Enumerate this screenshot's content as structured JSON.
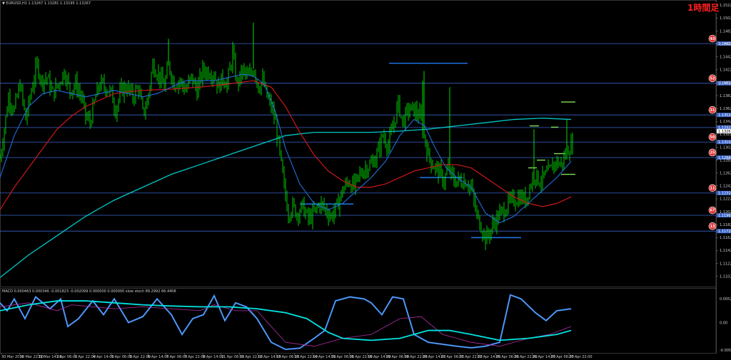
{
  "header": {
    "main_title": "▼ EURUSD,H1  1.13267 1.13281 1.13195 1.13267",
    "timeframe_badge": "1時間足",
    "macd_title": "MACD 0.000463 0.000346 -0.001823 -0.002099 0.000000 0.000000  slow stoch 89.2992 66.4408"
  },
  "colors": {
    "candle": "#00dd00",
    "sma_blue": "#1e6fd9",
    "sma_red": "#cc1818",
    "sma_cyan": "#00c8c8",
    "hline": "#3a64c8",
    "segment_blue": "#1e6fd9",
    "segment_green": "#7fe05a",
    "marker_red": "#e03030"
  },
  "chart_data": {
    "type": "candlestick",
    "symbol": "EURUSD",
    "timeframe": "H1",
    "ylim": [
      1.1085,
      1.153
    ],
    "price_ticks": [
      "1.15220",
      "1.15020",
      "1.14820",
      "1.14620",
      "1.14420",
      "1.14220",
      "1.14020",
      "1.13820",
      "1.13620",
      "1.13420",
      "1.13220",
      "1.13020",
      "1.12820",
      "1.12620",
      "1.12420",
      "1.12220",
      "1.12020",
      "1.11820",
      "1.11620",
      "1.11420",
      "1.11220",
      "1.11020"
    ],
    "x_ticks": [
      "30 Mar 2016",
      "30 Mar 22:00",
      "31 Mar 14:00",
      "1 Apr 06:00",
      "1 Apr 22:00",
      "4 Apr 14:00",
      "5 Apr 06:00",
      "5 Apr 22:00",
      "6 Apr 14:00",
      "7 Apr 06:00",
      "7 Apr 22:00",
      "8 Apr 14:00",
      "11 Apr 06:00",
      "11 Apr 22:00",
      "12 Apr 14:00",
      "13 Apr 06:00",
      "13 Apr 22:00",
      "14 Apr 14:00",
      "15 Apr 06:00",
      "15 Apr 22:00",
      "18 Apr 14:00",
      "19 Apr 06:00",
      "19 Apr 22:00",
      "20 Apr 14:00",
      "21 Apr 06:00",
      "21 Apr 22:00",
      "22 Apr 14:00",
      "25 Apr 06:00",
      "25 Apr 22:00",
      "26 Apr 14:00",
      "27 Apr 06:00",
      "27 Apr 22:00"
    ],
    "hlines": [
      {
        "y": 1.14625,
        "label": "1.14625",
        "marker": "43"
      },
      {
        "y": 1.1401,
        "label": "1.14010",
        "marker": "52"
      },
      {
        "y": 1.1352,
        "label": "1.13520",
        "marker": "31"
      },
      {
        "y": 1.13325,
        "label": "1.13325",
        "marker": null
      },
      {
        "y": 1.131,
        "label": "1.13100",
        "marker": "50"
      },
      {
        "y": 1.1286,
        "label": "1.12860",
        "marker": "25"
      },
      {
        "y": 1.1231,
        "label": "1.12310",
        "marker": "11"
      },
      {
        "y": 1.11965,
        "label": "1.11965",
        "marker": "67"
      },
      {
        "y": 1.1172,
        "label": "1.11720",
        "marker": "13"
      }
    ],
    "current_price": "1.13267",
    "close_path": [
      [
        0,
        1.1285
      ],
      [
        6,
        1.133
      ],
      [
        12,
        1.138
      ],
      [
        20,
        1.136
      ],
      [
        28,
        1.14
      ],
      [
        36,
        1.1345
      ],
      [
        44,
        1.139
      ],
      [
        52,
        1.143
      ],
      [
        58,
        1.1405
      ],
      [
        66,
        1.141
      ],
      [
        74,
        1.1385
      ],
      [
        82,
        1.14
      ],
      [
        90,
        1.142
      ],
      [
        98,
        1.139
      ],
      [
        106,
        1.14
      ],
      [
        114,
        1.138
      ],
      [
        120,
        1.135
      ],
      [
        126,
        1.134
      ],
      [
        134,
        1.138
      ],
      [
        140,
        1.14
      ],
      [
        148,
        1.1395
      ],
      [
        156,
        1.1385
      ],
      [
        162,
        1.136
      ],
      [
        170,
        1.139
      ],
      [
        178,
        1.1395
      ],
      [
        186,
        1.138
      ],
      [
        194,
        1.1395
      ],
      [
        200,
        1.1355
      ],
      [
        206,
        1.137
      ],
      [
        214,
        1.143
      ],
      [
        222,
        1.1415
      ],
      [
        230,
        1.1395
      ],
      [
        236,
        1.143
      ],
      [
        244,
        1.14
      ],
      [
        252,
        1.1405
      ],
      [
        260,
        1.139
      ],
      [
        268,
        1.141
      ],
      [
        276,
        1.139
      ],
      [
        284,
        1.142
      ],
      [
        292,
        1.142
      ],
      [
        300,
        1.1415
      ],
      [
        306,
        1.1395
      ],
      [
        312,
        1.141
      ],
      [
        318,
        1.14
      ],
      [
        326,
        1.1445
      ],
      [
        332,
        1.14
      ],
      [
        340,
        1.142
      ],
      [
        348,
        1.141
      ],
      [
        356,
        1.1425
      ],
      [
        362,
        1.1395
      ],
      [
        368,
        1.1405
      ],
      [
        374,
        1.138
      ],
      [
        380,
        1.1365
      ],
      [
        386,
        1.134
      ],
      [
        392,
        1.129
      ],
      [
        398,
        1.124
      ],
      [
        404,
        1.12
      ],
      [
        410,
        1.121
      ],
      [
        416,
        1.12
      ],
      [
        424,
        1.121
      ],
      [
        432,
        1.119
      ],
      [
        440,
        1.12
      ],
      [
        448,
        1.1215
      ],
      [
        456,
        1.1205
      ],
      [
        464,
        1.1195
      ],
      [
        472,
        1.121
      ],
      [
        480,
        1.1235
      ],
      [
        488,
        1.125
      ],
      [
        496,
        1.124
      ],
      [
        504,
        1.126
      ],
      [
        512,
        1.127
      ],
      [
        520,
        1.1275
      ],
      [
        528,
        1.129
      ],
      [
        536,
        1.132
      ],
      [
        544,
        1.1305
      ],
      [
        552,
        1.134
      ],
      [
        558,
        1.137
      ],
      [
        564,
        1.134
      ],
      [
        572,
        1.136
      ],
      [
        580,
        1.136
      ],
      [
        588,
        1.135
      ],
      [
        594,
        1.132
      ],
      [
        600,
        1.129
      ],
      [
        606,
        1.1275
      ],
      [
        614,
        1.1265
      ],
      [
        622,
        1.125
      ],
      [
        628,
        1.127
      ],
      [
        632,
        1.126
      ],
      [
        636,
        1.125
      ],
      [
        644,
        1.125
      ],
      [
        652,
        1.125
      ],
      [
        660,
        1.124
      ],
      [
        668,
        1.1195
      ],
      [
        674,
        1.118
      ],
      [
        680,
        1.116
      ],
      [
        686,
        1.117
      ],
      [
        692,
        1.1185
      ],
      [
        698,
        1.1195
      ],
      [
        706,
        1.1205
      ],
      [
        712,
        1.1215
      ],
      [
        720,
        1.122
      ],
      [
        728,
        1.1225
      ],
      [
        736,
        1.122
      ],
      [
        742,
        1.124
      ],
      [
        748,
        1.126
      ],
      [
        756,
        1.125
      ],
      [
        762,
        1.1255
      ],
      [
        770,
        1.1265
      ],
      [
        778,
        1.128
      ],
      [
        786,
        1.1275
      ],
      [
        794,
        1.1295
      ],
      [
        800,
        1.1305
      ]
    ],
    "spikes": [
      [
        355,
        1.1495
      ],
      [
        630,
        1.1395
      ],
      [
        592,
        1.1405
      ],
      [
        594,
        1.142
      ],
      [
        236,
        1.147
      ],
      [
        326,
        1.1465
      ],
      [
        748,
        1.133
      ],
      [
        794,
        1.1345
      ]
    ],
    "sma_blue": [
      [
        0,
        1.1255
      ],
      [
        20,
        1.132
      ],
      [
        40,
        1.1365
      ],
      [
        60,
        1.1385
      ],
      [
        80,
        1.139
      ],
      [
        100,
        1.1385
      ],
      [
        120,
        1.138
      ],
      [
        140,
        1.1385
      ],
      [
        160,
        1.139
      ],
      [
        180,
        1.1385
      ],
      [
        200,
        1.138
      ],
      [
        220,
        1.1385
      ],
      [
        240,
        1.1395
      ],
      [
        260,
        1.1405
      ],
      [
        280,
        1.1405
      ],
      [
        300,
        1.1405
      ],
      [
        320,
        1.141
      ],
      [
        340,
        1.1415
      ],
      [
        355,
        1.1412
      ],
      [
        370,
        1.14
      ],
      [
        385,
        1.136
      ],
      [
        400,
        1.13
      ],
      [
        420,
        1.1245
      ],
      [
        440,
        1.1215
      ],
      [
        460,
        1.1205
      ],
      [
        480,
        1.1215
      ],
      [
        500,
        1.1235
      ],
      [
        520,
        1.1255
      ],
      [
        540,
        1.128
      ],
      [
        560,
        1.132
      ],
      [
        580,
        1.1345
      ],
      [
        595,
        1.1335
      ],
      [
        610,
        1.13
      ],
      [
        625,
        1.127
      ],
      [
        640,
        1.1255
      ],
      [
        660,
        1.124
      ],
      [
        680,
        1.12
      ],
      [
        700,
        1.1185
      ],
      [
        720,
        1.1195
      ],
      [
        740,
        1.1215
      ],
      [
        760,
        1.1235
      ],
      [
        780,
        1.1255
      ],
      [
        800,
        1.128
      ]
    ],
    "sma_red": [
      [
        0,
        1.1205
      ],
      [
        20,
        1.124
      ],
      [
        40,
        1.127
      ],
      [
        60,
        1.13
      ],
      [
        80,
        1.133
      ],
      [
        100,
        1.135
      ],
      [
        120,
        1.1365
      ],
      [
        140,
        1.1375
      ],
      [
        160,
        1.1385
      ],
      [
        180,
        1.1388
      ],
      [
        200,
        1.139
      ],
      [
        240,
        1.1392
      ],
      [
        280,
        1.1395
      ],
      [
        320,
        1.14
      ],
      [
        355,
        1.1405
      ],
      [
        380,
        1.1395
      ],
      [
        400,
        1.1365
      ],
      [
        420,
        1.1325
      ],
      [
        440,
        1.129
      ],
      [
        460,
        1.1265
      ],
      [
        480,
        1.125
      ],
      [
        500,
        1.124
      ],
      [
        520,
        1.124
      ],
      [
        540,
        1.1245
      ],
      [
        560,
        1.1255
      ],
      [
        580,
        1.1265
      ],
      [
        600,
        1.127
      ],
      [
        620,
        1.1275
      ],
      [
        640,
        1.1275
      ],
      [
        660,
        1.127
      ],
      [
        680,
        1.1255
      ],
      [
        700,
        1.124
      ],
      [
        720,
        1.1225
      ],
      [
        740,
        1.1215
      ],
      [
        760,
        1.121
      ],
      [
        780,
        1.1215
      ],
      [
        800,
        1.1225
      ]
    ],
    "sma_cyan": [
      [
        0,
        1.11
      ],
      [
        40,
        1.1135
      ],
      [
        80,
        1.1165
      ],
      [
        120,
        1.1195
      ],
      [
        160,
        1.122
      ],
      [
        200,
        1.124
      ],
      [
        240,
        1.126
      ],
      [
        280,
        1.1275
      ],
      [
        320,
        1.129
      ],
      [
        360,
        1.1305
      ],
      [
        400,
        1.132
      ],
      [
        440,
        1.1325
      ],
      [
        480,
        1.1325
      ],
      [
        520,
        1.1325
      ],
      [
        560,
        1.1327
      ],
      [
        600,
        1.133
      ],
      [
        640,
        1.1335
      ],
      [
        680,
        1.134
      ],
      [
        720,
        1.1345
      ],
      [
        760,
        1.1347
      ],
      [
        800,
        1.1345
      ]
    ],
    "segments_blue": [
      [
        545,
        605,
        1.1432
      ],
      [
        605,
        655,
        1.1432
      ],
      [
        588,
        648,
        1.1255
      ],
      [
        420,
        495,
        1.1214
      ],
      [
        660,
        730,
        1.1162
      ]
    ],
    "segments_green": [
      [
        786,
        806,
        1.1372
      ],
      [
        742,
        755,
        1.1335
      ],
      [
        772,
        782,
        1.1333
      ],
      [
        740,
        752,
        1.127
      ],
      [
        752,
        764,
        1.1282
      ],
      [
        776,
        792,
        1.1292
      ],
      [
        786,
        806,
        1.126
      ]
    ],
    "macd": {
      "ylim": [
        -0.0075,
        0.0075
      ],
      "tick_labels": [
        "0.005271",
        "0.00",
        "-0.005794"
      ],
      "line_cyan": [
        [
          0,
          0.003
        ],
        [
          40,
          0.0045
        ],
        [
          80,
          0.0055
        ],
        [
          120,
          0.0055
        ],
        [
          160,
          0.005
        ],
        [
          200,
          0.0045
        ],
        [
          240,
          0.0042
        ],
        [
          280,
          0.004
        ],
        [
          320,
          0.004
        ],
        [
          360,
          0.0035
        ],
        [
          400,
          0.0025
        ],
        [
          430,
          0.001
        ],
        [
          460,
          -0.0025
        ],
        [
          480,
          -0.004
        ],
        [
          520,
          -0.0045
        ],
        [
          560,
          -0.004
        ],
        [
          600,
          -0.002
        ],
        [
          630,
          -0.002
        ],
        [
          660,
          -0.003
        ],
        [
          700,
          -0.0045
        ],
        [
          740,
          -0.004
        ],
        [
          780,
          -0.003
        ],
        [
          800,
          -0.002
        ]
      ],
      "line_purple": [
        [
          0,
          0.004
        ],
        [
          40,
          0.005
        ],
        [
          80,
          0.003
        ],
        [
          100,
          0.0045
        ],
        [
          130,
          0.004
        ],
        [
          160,
          0.0035
        ],
        [
          200,
          0.004
        ],
        [
          240,
          0.0035
        ],
        [
          280,
          0.003
        ],
        [
          300,
          0.0045
        ],
        [
          330,
          0.003
        ],
        [
          360,
          0.003
        ],
        [
          400,
          -0.005
        ],
        [
          440,
          -0.006
        ],
        [
          480,
          -0.004
        ],
        [
          520,
          -0.003
        ],
        [
          560,
          0.001
        ],
        [
          590,
          0.0015
        ],
        [
          620,
          -0.003
        ],
        [
          660,
          -0.005
        ],
        [
          700,
          -0.006
        ],
        [
          740,
          -0.004
        ],
        [
          770,
          -0.003
        ],
        [
          800,
          -0.001
        ]
      ],
      "stoch_blue": [
        [
          0,
          0.005
        ],
        [
          10,
          0.003
        ],
        [
          20,
          0.006
        ],
        [
          35,
          0.001
        ],
        [
          50,
          0.0065
        ],
        [
          70,
          0.0035
        ],
        [
          85,
          0.006
        ],
        [
          95,
          -0.001
        ],
        [
          110,
          0.001
        ],
        [
          130,
          0.0055
        ],
        [
          145,
          0.002
        ],
        [
          160,
          0.006
        ],
        [
          180,
          0.0
        ],
        [
          200,
          0.0015
        ],
        [
          220,
          0.006
        ],
        [
          240,
          0.002
        ],
        [
          255,
          -0.003
        ],
        [
          270,
          0.001
        ],
        [
          285,
          0.002
        ],
        [
          300,
          0.0068
        ],
        [
          315,
          0.0005
        ],
        [
          330,
          0.005
        ],
        [
          345,
          0.004
        ],
        [
          360,
          0.001
        ],
        [
          380,
          -0.005
        ],
        [
          400,
          -0.0068
        ],
        [
          420,
          -0.0065
        ],
        [
          440,
          -0.004
        ],
        [
          455,
          -0.002
        ],
        [
          470,
          0.0055
        ],
        [
          490,
          0.0065
        ],
        [
          510,
          0.006
        ],
        [
          520,
          0.005
        ],
        [
          535,
          0.002
        ],
        [
          550,
          0.0065
        ],
        [
          565,
          0.006
        ],
        [
          580,
          -0.003
        ],
        [
          600,
          -0.005
        ],
        [
          620,
          -0.0055
        ],
        [
          640,
          -0.006
        ],
        [
          660,
          -0.0064
        ],
        [
          680,
          -0.006
        ],
        [
          700,
          -0.005
        ],
        [
          715,
          0.007
        ],
        [
          730,
          0.006
        ],
        [
          750,
          0.0025
        ],
        [
          765,
          0.0005
        ],
        [
          780,
          0.003
        ],
        [
          800,
          0.0035
        ]
      ]
    }
  }
}
